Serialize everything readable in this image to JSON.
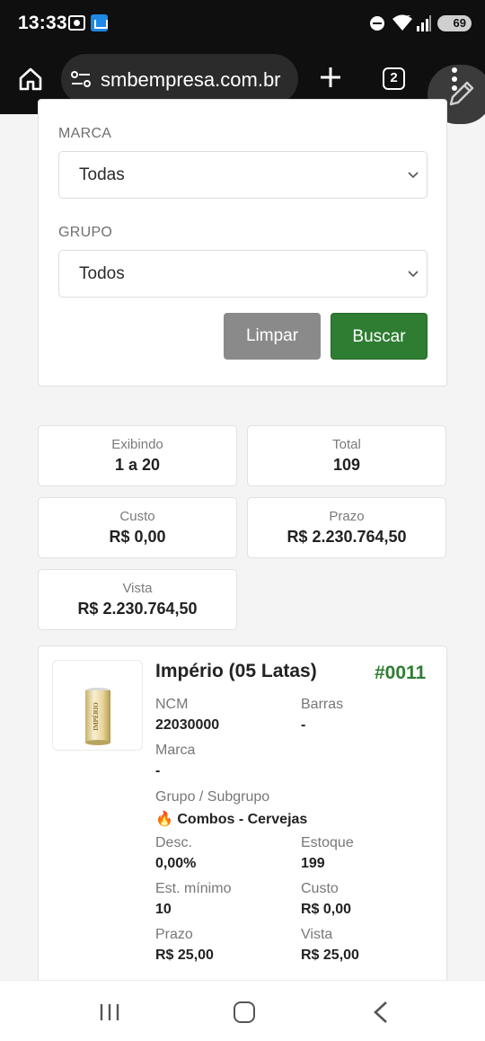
{
  "status_bar": {
    "time": "13:33",
    "battery": "69",
    "icons": [
      "screenshot-icon",
      "gallery-icon",
      "do-not-disturb-icon",
      "wifi-icon",
      "signal-icon",
      "battery-icon"
    ]
  },
  "browser": {
    "url": "smbempresa.com.br",
    "tab_count": "2",
    "icons": [
      "home-icon",
      "site-settings-icon",
      "plus-icon",
      "tabs-icon",
      "more-vert-icon",
      "pencil-icon"
    ]
  },
  "filters": {
    "marca_label": "MARCA",
    "marca_value": "Todas",
    "grupo_label": "GRUPO",
    "grupo_value": "Todos",
    "clear_label": "Limpar",
    "search_label": "Buscar"
  },
  "stats": {
    "exibindo_label": "Exibindo",
    "exibindo_value": "1 a 20",
    "total_label": "Total",
    "total_value": "109",
    "custo_label": "Custo",
    "custo_value": "R$ 0,00",
    "prazo_label": "Prazo",
    "prazo_value": "R$ 2.230.764,50",
    "vista_label": "Vista",
    "vista_value": "R$ 2.230.764,50"
  },
  "product": {
    "title": "Império (05 Latas)",
    "code": "#0011",
    "ncm_label": "NCM",
    "ncm_value": "22030000",
    "barras_label": "Barras",
    "barras_value": "-",
    "marca_label": "Marca",
    "marca_value": "-",
    "grupo_label": "Grupo / Subgrupo",
    "grupo_emoji": "🔥",
    "grupo_value": "Combos - Cervejas",
    "desc_label": "Desc.",
    "desc_value": "0,00%",
    "estoque_label": "Estoque",
    "estoque_value": "199",
    "estmin_label": "Est. mínimo",
    "estmin_value": "10",
    "custo_label": "Custo",
    "custo_value": "R$ 0,00",
    "prazo_label": "Prazo",
    "prazo_value": "R$ 25,00",
    "vista_label": "Vista",
    "vista_value": "R$ 25,00",
    "image_label": "IMPÉRIO"
  },
  "nav": {
    "icons": [
      "recent-apps-icon",
      "home-nav-icon",
      "back-icon"
    ]
  }
}
